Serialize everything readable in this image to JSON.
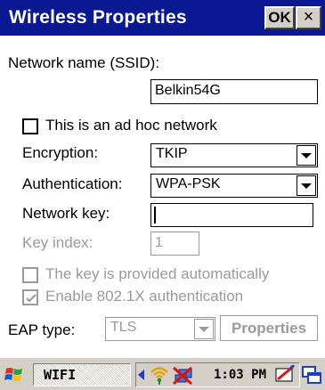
{
  "window": {
    "title": "Wireless Properties",
    "ok_label": "OK",
    "close_label": "×"
  },
  "form": {
    "ssid_label": "Network name (SSID):",
    "ssid_value": "Belkin54G",
    "adhoc_label": "This is an ad hoc network",
    "adhoc_checked": false,
    "encryption_label": "Encryption:",
    "encryption_value": "TKIP",
    "authentication_label": "Authentication:",
    "authentication_value": "WPA-PSK",
    "network_key_label": "Network key:",
    "network_key_value": "",
    "key_index_label": "Key index:",
    "key_index_value": "1",
    "auto_key_label": "The key is provided automatically",
    "auto_key_checked": false,
    "enable_8021x_label": "Enable 802.1X authentication",
    "enable_8021x_checked": true,
    "eap_type_label": "EAP type:",
    "eap_type_value": "TLS",
    "properties_label": "Properties"
  },
  "taskbar": {
    "task_label": "WIFI",
    "clock": "1:03 PM"
  },
  "colors": {
    "titlebar": "#0a1894",
    "disabled": "#9a9a9a",
    "taskbar": "#d4d0c8"
  },
  "icons": [
    "windows-start-icon",
    "arrow-left-icon",
    "wifi-signal-icon",
    "network-connection-icon",
    "pen-input-icon",
    "window-switcher-icon"
  ]
}
